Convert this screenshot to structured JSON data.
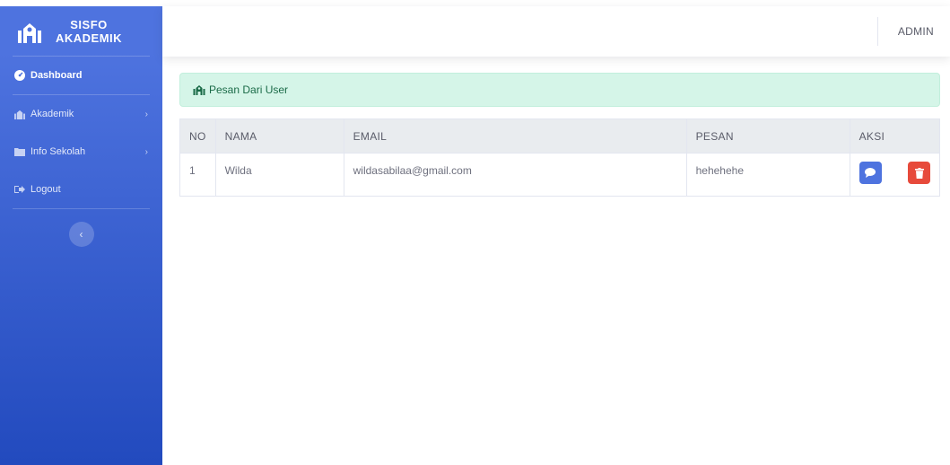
{
  "brand": {
    "line1": "SISFO",
    "line2": "AKADEMIK"
  },
  "sidebar": {
    "items": [
      {
        "label": "Dashboard",
        "icon": "tachometer-icon"
      },
      {
        "label": "Akademik",
        "icon": "school-icon"
      },
      {
        "label": "Info Sekolah",
        "icon": "folder-icon"
      },
      {
        "label": "Logout",
        "icon": "sign-out-icon"
      }
    ],
    "chevron": "›",
    "toggle": "‹"
  },
  "topbar": {
    "user": "ADMIN"
  },
  "alert": {
    "text": "Pesan Dari User"
  },
  "table": {
    "headers": [
      "NO",
      "NAMA",
      "EMAIL",
      "PESAN",
      "AKSI"
    ],
    "rows": [
      {
        "no": "1",
        "nama": "Wilda",
        "email": "wildasabilaa@gmail.com",
        "pesan": "hehehehe"
      }
    ]
  },
  "colors": {
    "primary": "#4e73df",
    "danger": "#e74a3b",
    "alert_bg": "#d5f5e8"
  }
}
